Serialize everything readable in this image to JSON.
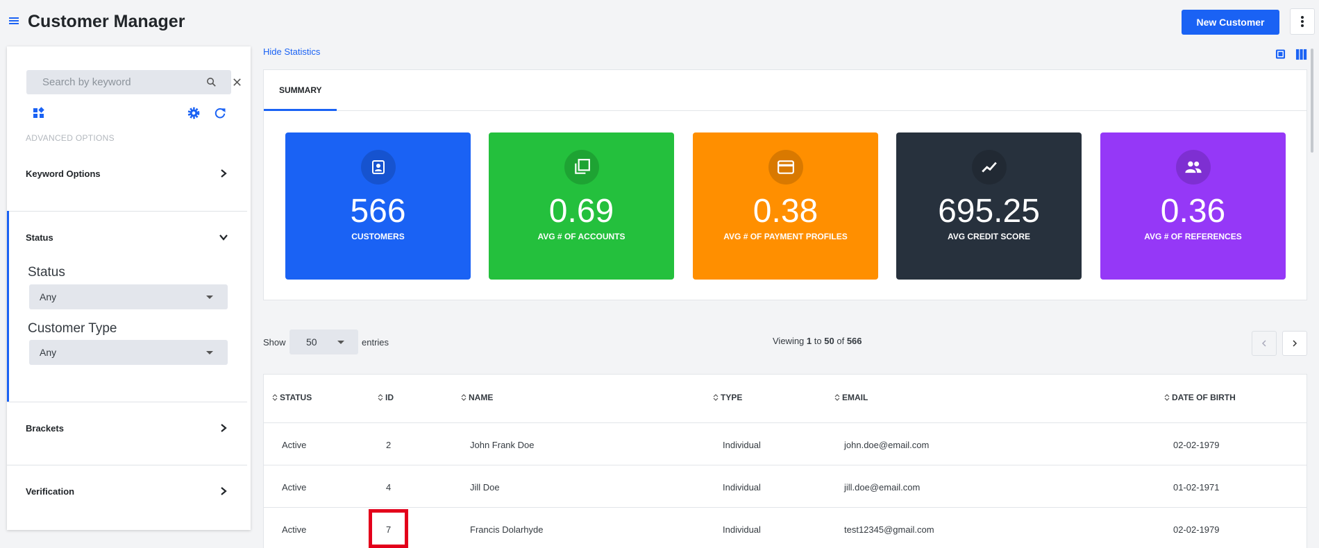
{
  "header": {
    "title": "Customer Manager",
    "new_button": "New Customer",
    "menu_icon": "hamburger-icon",
    "more_icon": "kebab-menu-icon"
  },
  "sidebar": {
    "search_placeholder": "Search by keyword",
    "advanced_options": "ADVANCED OPTIONS",
    "sections": {
      "keyword": "Keyword Options",
      "status": "Status",
      "brackets": "Brackets",
      "verification": "Verification"
    },
    "filters": {
      "status_label": "Status",
      "status_value": "Any",
      "type_label": "Customer Type",
      "type_value": "Any"
    }
  },
  "main": {
    "hide_stats": "Hide Statistics",
    "tab": "SUMMARY",
    "stats": [
      {
        "value": "566",
        "label": "CUSTOMERS",
        "color": "#1a62f4",
        "icon": "contact-card-icon"
      },
      {
        "value": "0.69",
        "label": "AVG # OF ACCOUNTS",
        "color": "#24c03d",
        "icon": "copy-stack-icon"
      },
      {
        "value": "0.38",
        "label": "AVG # OF PAYMENT PROFILES",
        "color": "#ff8f00",
        "icon": "credit-card-icon"
      },
      {
        "value": "695.25",
        "label": "AVG CREDIT SCORE",
        "color": "#27313d",
        "icon": "trend-line-icon"
      },
      {
        "value": "0.36",
        "label": "AVG # OF REFERENCES",
        "color": "#9538f7",
        "icon": "people-group-icon"
      }
    ],
    "show_label": "Show",
    "entries_value": "50",
    "entries_label": "entries",
    "viewing": {
      "prefix": "Viewing",
      "from": "1",
      "to_word": "to",
      "to": "50",
      "of_word": "of",
      "total": "566"
    }
  },
  "table": {
    "columns": [
      "STATUS",
      "ID",
      "NAME",
      "TYPE",
      "EMAIL",
      "DATE OF BIRTH"
    ],
    "rows": [
      {
        "status": "Active",
        "id": "2",
        "name": "John Frank Doe",
        "type": "Individual",
        "email": "john.doe@email.com",
        "dob": "02-02-1979"
      },
      {
        "status": "Active",
        "id": "4",
        "name": "Jill Doe",
        "type": "Individual",
        "email": "jill.doe@email.com",
        "dob": "01-02-1971"
      },
      {
        "status": "Active",
        "id": "7",
        "name": "Francis Dolarhyde",
        "type": "Individual",
        "email": "test12345@gmail.com",
        "dob": "02-02-1979"
      }
    ]
  },
  "colors": {
    "accent": "#1a62f4",
    "highlight": "#e3001b"
  }
}
